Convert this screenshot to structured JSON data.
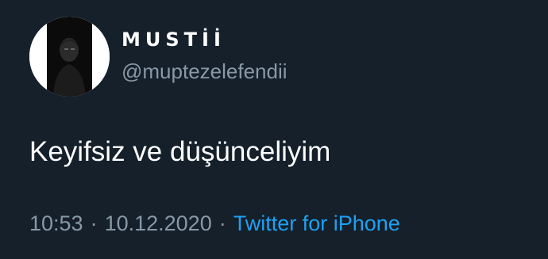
{
  "tweet": {
    "author": {
      "display_name": "MUSTİİ",
      "handle": "@muptezelefendii"
    },
    "text": "Keyifsiz ve düşünceliyim",
    "time": "10:53",
    "date": "10.12.2020",
    "separator": "·",
    "source": "Twitter for iPhone"
  },
  "colors": {
    "background": "#15202b",
    "text_primary": "#ffffff",
    "text_secondary": "#8899a6",
    "link": "#1da1f2"
  }
}
